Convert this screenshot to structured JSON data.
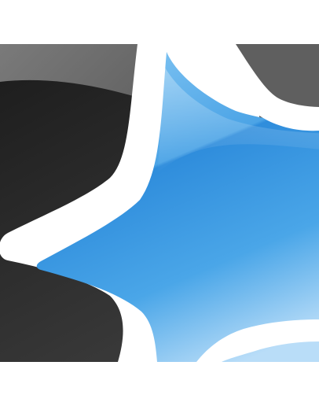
{
  "app_icon": {
    "icon_name": "star-icon",
    "colors": {
      "background_dark": "#262626",
      "background_light": "#6a6a6a",
      "outline": "#ffffff",
      "star_light": "#a9d6f7",
      "star_mid": "#5bb0ea",
      "star_deep": "#2b84d6"
    }
  }
}
